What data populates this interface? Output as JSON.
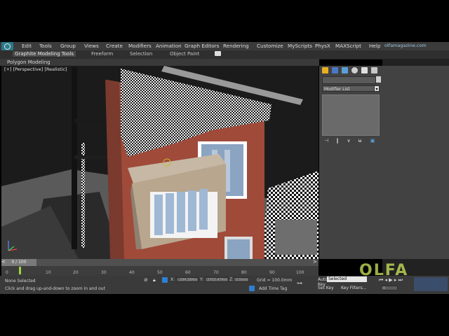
{
  "watermark": "olfamagazine.com",
  "menu": [
    "Edit",
    "Tools",
    "Group",
    "Views",
    "Create",
    "Modifiers",
    "Animation",
    "Graph Editors",
    "Rendering",
    "Customize",
    "MyScripts",
    "PhysX",
    "MAXScript",
    "Help"
  ],
  "ribbon": {
    "tabs": [
      "Graphite Modeling Tools",
      "Freeform",
      "Selection",
      "Object Paint"
    ],
    "sub_label": "Polygon Modeling"
  },
  "viewport": {
    "label": "[+] [Perspective] [Realistic]"
  },
  "command_panel": {
    "modifier_list": "Modifier List"
  },
  "timeline": {
    "slider": "0 / 100",
    "ticks": [
      "0",
      "10",
      "20",
      "30",
      "40",
      "50",
      "60",
      "70",
      "80",
      "90",
      "100"
    ]
  },
  "status": {
    "selection": "None Selected",
    "prompt": "Click and drag up-and-down to zoom in and out",
    "x_value": "-294.384m",
    "y_value": "3703.474m",
    "z_value": "0.0mm",
    "grid": "Grid = 100.0mm",
    "add_time_tag": "Add Time Tag",
    "auto_key": "Auto Key",
    "set_key": "Set Key",
    "key_filters": "Key Filters...",
    "selected_mode": "Selected",
    "current_frame": "0"
  },
  "brand_overlay": "OLFA",
  "colors": {
    "menubar": "#3b3b3b",
    "viewport_bg": "#5a5a5a",
    "accent_blue": "#2f7fd0",
    "wall": "#a04a3a",
    "frame_marker": "#9cd43c"
  }
}
